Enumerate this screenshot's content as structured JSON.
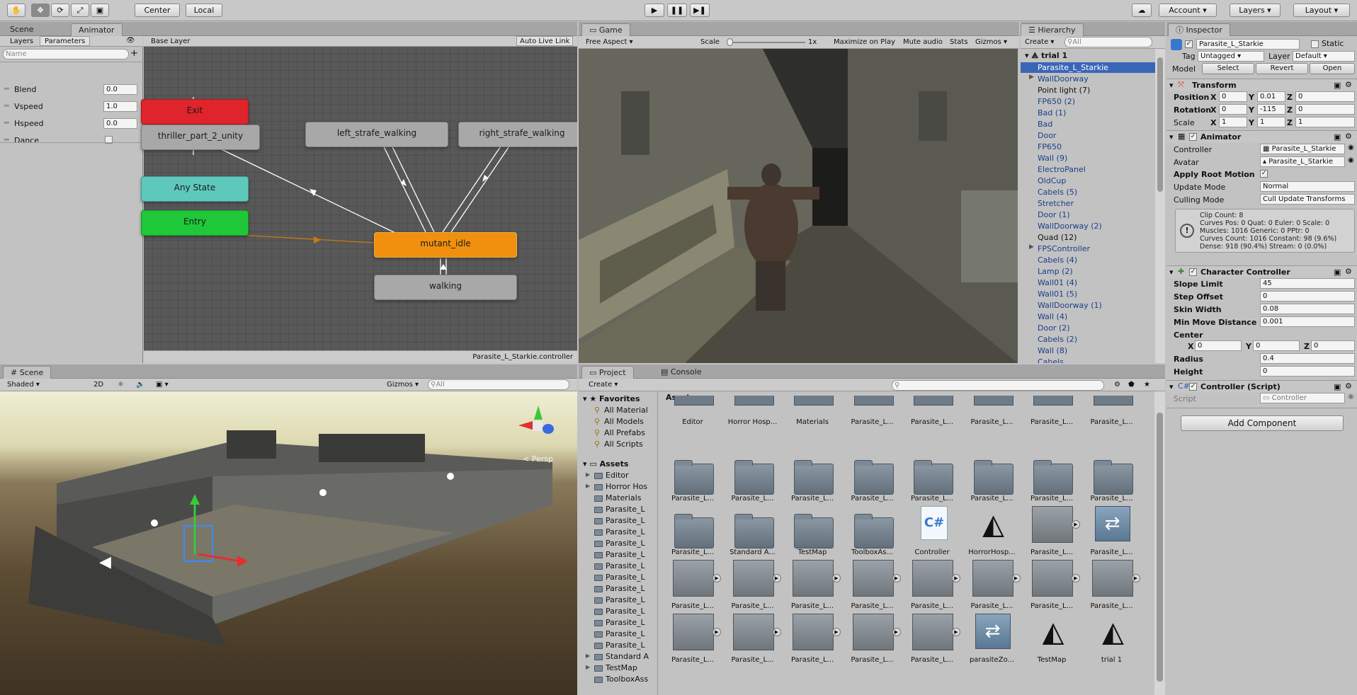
{
  "toolbar": {
    "pivot": "Center",
    "space": "Local",
    "account": "Account ▾",
    "layers": "Layers ▾",
    "layout": "Layout ▾"
  },
  "animator": {
    "tab_scene": "Scene",
    "tab_animator": "Animator",
    "sub_layers": "Layers",
    "sub_parameters": "Parameters",
    "name_placeholder": "Name",
    "base_layer": "Base Layer",
    "auto_live_link": "Auto Live Link",
    "params": [
      {
        "name": "Blend",
        "value": "0.0"
      },
      {
        "name": "Vspeed",
        "value": "1.0"
      },
      {
        "name": "Hspeed",
        "value": "0.0"
      },
      {
        "name": "Dance",
        "value": ""
      }
    ],
    "nodes": {
      "exit": "Exit",
      "thriller": "thriller_part_2_unity",
      "any_state": "Any State",
      "entry": "Entry",
      "left": "left_strafe_walking",
      "right": "right_strafe_walking",
      "idle": "mutant_idle",
      "walking": "walking"
    },
    "footer": "Parasite_L_Starkie.controller"
  },
  "game": {
    "tab": "Game",
    "aspect": "Free Aspect",
    "scale_label": "Scale",
    "scale_value": "1x",
    "maximize": "Maximize on Play",
    "mute": "Mute audio",
    "stats": "Stats",
    "gizmos": "Gizmos"
  },
  "hierarchy": {
    "tab": "Hierarchy",
    "create": "Create",
    "search_placeholder": "All",
    "root": "trial 1",
    "items": [
      "Parasite_L_Starkie",
      "WallDoorway",
      "Point light (7)",
      "FP650 (2)",
      "Bad (1)",
      "Bad",
      "Door",
      "FP650",
      "Wall (9)",
      "ElectroPanel",
      "OldCup",
      "Cabels (5)",
      "Stretcher",
      "Door (1)",
      "WallDoorway (2)",
      "Quad (12)",
      "FPSController",
      "Cabels (4)",
      "Lamp (2)",
      "Wall01 (4)",
      "Wall01 (5)",
      "WallDoorway (1)",
      "Wall (4)",
      "Door (2)",
      "Cabels (2)",
      "Wall (8)",
      "Cabels"
    ]
  },
  "scene": {
    "tab": "Scene",
    "shading": "Shaded",
    "mode_2d": "2D",
    "gizmos": "Gizmos",
    "search_placeholder": "All",
    "persp": "Persp"
  },
  "project": {
    "tab_project": "Project",
    "tab_console": "Console",
    "create": "Create",
    "favorites": "Favorites",
    "fav_items": [
      "All Material",
      "All Models",
      "All Prefabs",
      "All Scripts"
    ],
    "assets_root": "Assets",
    "tree": [
      "Editor",
      "Horror Hos",
      "Materials",
      "Parasite_L",
      "Parasite_L",
      "Parasite_L",
      "Parasite_L",
      "Parasite_L",
      "Parasite_L",
      "Parasite_L",
      "Parasite_L",
      "Parasite_L",
      "Parasite_L",
      "Parasite_L",
      "Parasite_L",
      "Parasite_L",
      "Standard A",
      "TestMap",
      "ToolboxAss"
    ],
    "breadcrumb": "Assets ▸",
    "row1": [
      "Editor",
      "Horror Hosp...",
      "Materials",
      "Parasite_L...",
      "Parasite_L...",
      "Parasite_L...",
      "Parasite_L...",
      "Parasite_L..."
    ],
    "row2": [
      "Parasite_L...",
      "Parasite_L...",
      "Parasite_L...",
      "Parasite_L...",
      "Parasite_L...",
      "Parasite_L...",
      "Parasite_L...",
      "Parasite_L..."
    ],
    "row3": [
      "Parasite_L...",
      "Standard A...",
      "TestMap",
      "ToolboxAs...",
      "Controller",
      "HorrorHosp...",
      "Parasite_L...",
      "Parasite_L..."
    ],
    "row4": [
      "Parasite_L...",
      "Parasite_L...",
      "Parasite_L...",
      "Parasite_L...",
      "Parasite_L...",
      "Parasite_L...",
      "Parasite_L...",
      "Parasite_L..."
    ],
    "row5": [
      "Parasite_L...",
      "Parasite_L...",
      "Parasite_L...",
      "Parasite_L...",
      "Parasite_L...",
      "parasiteZo...",
      "TestMap",
      "trial 1"
    ]
  },
  "inspector": {
    "tab": "Inspector",
    "object_name": "Parasite_L_Starkie",
    "static": "Static",
    "tag_label": "Tag",
    "tag": "Untagged",
    "layer_label": "Layer",
    "layer": "Default",
    "model_label": "Model",
    "select": "Select",
    "revert": "Revert",
    "open": "Open",
    "transform": {
      "title": "Transform",
      "position": "Position",
      "rotation": "Rotation",
      "scale": "Scale",
      "pos": [
        "0",
        "0.01",
        "0"
      ],
      "rot": [
        "0",
        "-115",
        "0"
      ],
      "scl": [
        "1",
        "1",
        "1"
      ]
    },
    "animator": {
      "title": "Animator",
      "controller_label": "Controller",
      "controller": "Parasite_L_Starkie",
      "avatar_label": "Avatar",
      "avatar": "Parasite_L_Starkie",
      "root_motion": "Apply Root Motion",
      "update_mode_label": "Update Mode",
      "update_mode": "Normal",
      "culling_label": "Culling Mode",
      "culling": "Cull Update Transforms",
      "info": [
        "Clip Count: 8",
        "Curves Pos: 0 Quat: 0 Euler: 0 Scale: 0",
        "Muscles: 1016 Generic: 0 PPtr: 0",
        "Curves Count: 1016 Constant: 98 (9.6%)",
        "Dense: 918 (90.4%) Stream: 0 (0.0%)"
      ]
    },
    "cc": {
      "title": "Character Controller",
      "slope_label": "Slope Limit",
      "slope": "45",
      "step_label": "Step Offset",
      "step": "0",
      "skin_label": "Skin Width",
      "skin": "0.08",
      "minmove_label": "Min Move Distance",
      "minmove": "0.001",
      "center_label": "Center",
      "center": [
        "0",
        "0",
        "0"
      ],
      "radius_label": "Radius",
      "radius": "0.4",
      "height_label": "Height",
      "height": "0"
    },
    "script": {
      "title": "Controller (Script)",
      "label": "Script",
      "value": "Controller"
    },
    "add_component": "Add Component"
  },
  "colors": {
    "node_exit": "#e0242c",
    "node_any": "#5fc8bc",
    "node_entry": "#1fc838",
    "node_idle": "#f0900e",
    "node_default": "#a8a8a8",
    "selected_blue": "#3a66b8"
  }
}
